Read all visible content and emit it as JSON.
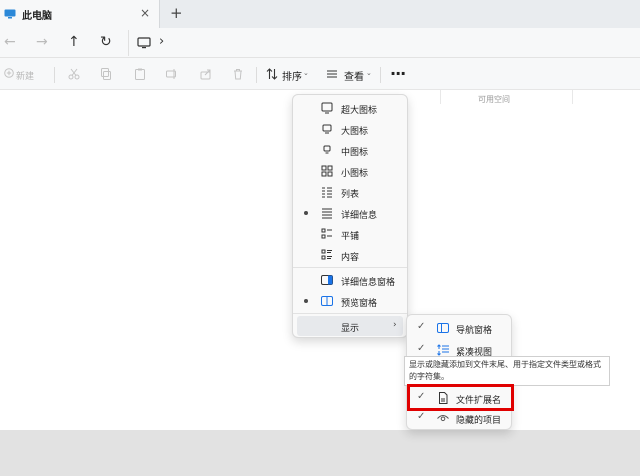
{
  "tab": {
    "title": "此电脑",
    "close": "×",
    "new_tab": "+"
  },
  "nav": {
    "back": "←",
    "forward": "→",
    "up": "↑",
    "refresh": "↻",
    "chevron": "›"
  },
  "toolbar": {
    "new_label": "新建",
    "sort_label": "排序",
    "view_label": "查看",
    "caret": "⌄",
    "more": "···"
  },
  "content": {
    "col_free_space": "可用空间"
  },
  "view_menu": {
    "items": [
      {
        "label": "超大图标",
        "icon": "monitor-large-icon",
        "selected": false
      },
      {
        "label": "大图标",
        "icon": "monitor-icon",
        "selected": false
      },
      {
        "label": "中图标",
        "icon": "monitor-medium-icon",
        "selected": false
      },
      {
        "label": "小图标",
        "icon": "small-icons-grid-icon",
        "selected": false
      },
      {
        "label": "列表",
        "icon": "list-icon",
        "selected": false
      },
      {
        "label": "详细信息",
        "icon": "details-icon",
        "selected": true
      },
      {
        "label": "平铺",
        "icon": "tiles-icon",
        "selected": false
      },
      {
        "label": "内容",
        "icon": "content-icon",
        "selected": false
      },
      {
        "label": "详细信息窗格",
        "icon": "details-pane-icon",
        "selected": false
      },
      {
        "label": "预览窗格",
        "icon": "preview-pane-icon",
        "selected": true
      }
    ],
    "show_label": "显示",
    "show_arrow": "›"
  },
  "show_submenu": {
    "items": [
      {
        "label": "导航窗格",
        "checked": true,
        "icon": "navigation-pane-icon"
      },
      {
        "label": "紧凑视图",
        "checked": true,
        "icon": "compact-view-icon"
      },
      {
        "label": "文件扩展名",
        "checked": true,
        "icon": "file-icon"
      },
      {
        "label": "隐藏的项目",
        "checked": true,
        "icon": "eye-icon"
      }
    ],
    "check": "✓"
  },
  "tooltip": {
    "text": "显示或隐藏添加到文件末尾、用于指定文件类型或格式的字符集。"
  },
  "colors": {
    "accent": "#1a73e8",
    "highlight": "#e00000"
  }
}
